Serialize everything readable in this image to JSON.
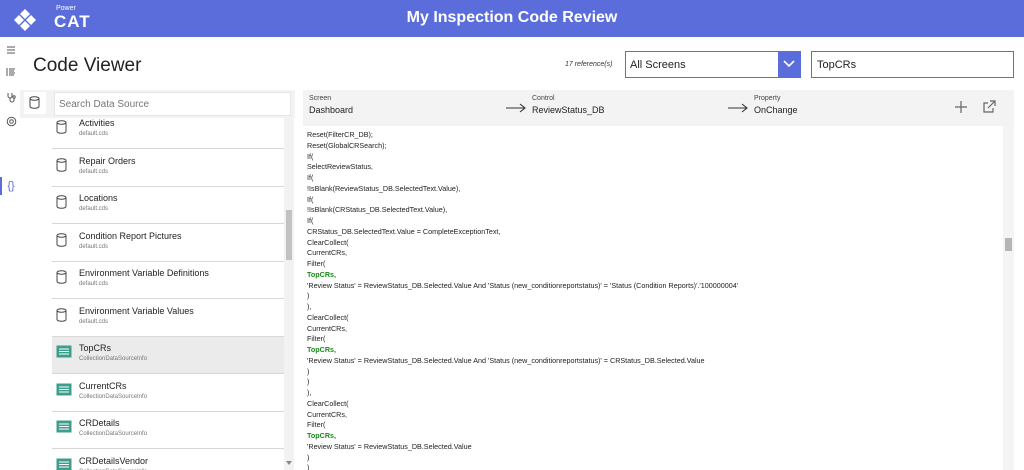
{
  "header": {
    "brand_small": "Power",
    "brand_big": "CAT",
    "title": "My Inspection Code Review"
  },
  "leftnav": {
    "icons": [
      "menu-icon",
      "list-icon",
      "stethoscope-icon",
      "at-icon",
      "braces-icon"
    ]
  },
  "page": {
    "title": "Code Viewer"
  },
  "toolbar": {
    "reference_count": "17 reference(s)",
    "screen_select": "All Screens",
    "search_value": "TopCRs"
  },
  "datasources": {
    "search_placeholder": "Search Data Source",
    "items": [
      {
        "name": "Activities",
        "sub": "default.cds",
        "icon": "database-icon"
      },
      {
        "name": "Repair Orders",
        "sub": "default.cds",
        "icon": "database-icon"
      },
      {
        "name": "Locations",
        "sub": "default.cds",
        "icon": "database-icon"
      },
      {
        "name": "Condition Report Pictures",
        "sub": "default.cds",
        "icon": "database-icon"
      },
      {
        "name": "Environment Variable Definitions",
        "sub": "default.cds",
        "icon": "database-icon"
      },
      {
        "name": "Environment Variable Values",
        "sub": "default.cds",
        "icon": "database-icon"
      },
      {
        "name": "TopCRs",
        "sub": "CollectionDataSourceInfo",
        "icon": "collection-icon",
        "selected": true
      },
      {
        "name": "CurrentCRs",
        "sub": "CollectionDataSourceInfo",
        "icon": "collection-icon"
      },
      {
        "name": "CRDetails",
        "sub": "CollectionDataSourceInfo",
        "icon": "collection-icon"
      },
      {
        "name": "CRDetailsVendor",
        "sub": "CollectionDataSourceInfo",
        "icon": "collection-icon"
      }
    ]
  },
  "breadcrumb": {
    "screen_label": "Screen",
    "screen_value": "Dashboard",
    "control_label": "Control",
    "control_value": "ReviewStatus_DB",
    "property_label": "Property",
    "property_value": "OnChange"
  },
  "code": {
    "lines": [
      {
        "text": "Reset(FilterCR_DB);"
      },
      {
        "text": "Reset(GlobalCRSearch);"
      },
      {
        "text": "If("
      },
      {
        "text": "SelectReviewStatus,"
      },
      {
        "text": "If("
      },
      {
        "text": "!IsBlank(ReviewStatus_DB.SelectedText.Value),"
      },
      {
        "text": "If("
      },
      {
        "text": "!IsBlank(CRStatus_DB.SelectedText.Value),"
      },
      {
        "text": "If("
      },
      {
        "text": "CRStatus_DB.SelectedText.Value = CompleteExceptionText,"
      },
      {
        "text": "ClearCollect("
      },
      {
        "text": "CurrentCRs,"
      },
      {
        "text": "Filter("
      },
      {
        "text": "TopCRs,",
        "highlight": true
      },
      {
        "text": "'Review Status' = ReviewStatus_DB.Selected.Value And 'Status (new_conditionreportstatus)' = 'Status (Condition Reports)'.'100000004'"
      },
      {
        "text": ")"
      },
      {
        "text": "),"
      },
      {
        "text": "ClearCollect("
      },
      {
        "text": "CurrentCRs,"
      },
      {
        "text": "Filter("
      },
      {
        "text": "TopCRs,",
        "highlight": true
      },
      {
        "text": "'Review Status' = ReviewStatus_DB.Selected.Value And 'Status (new_conditionreportstatus)' = CRStatus_DB.Selected.Value"
      },
      {
        "text": ")"
      },
      {
        "text": ")"
      },
      {
        "text": "),"
      },
      {
        "text": "ClearCollect("
      },
      {
        "text": "CurrentCRs,"
      },
      {
        "text": "Filter("
      },
      {
        "text": "TopCRs,",
        "highlight": true
      },
      {
        "text": "'Review Status' = ReviewStatus_DB.Selected.Value"
      },
      {
        "text": ")"
      },
      {
        "text": ")"
      }
    ]
  },
  "colors": {
    "accent": "#5b6ddb",
    "highlight": "#1a8a1a",
    "collection_icon": "#3d9e8c"
  }
}
